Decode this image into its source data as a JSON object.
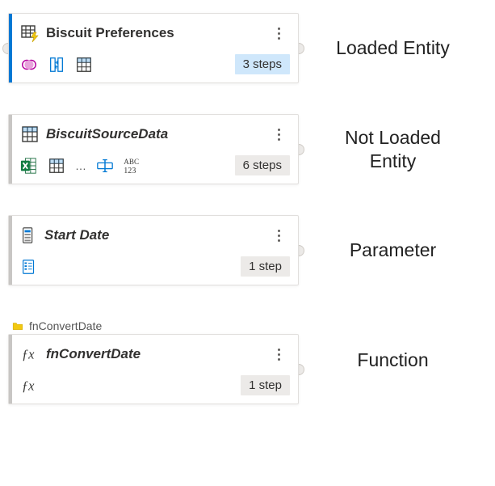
{
  "labels": {
    "loaded_entity": "Loaded Entity",
    "not_loaded_entity": "Not Loaded\nEntity",
    "parameter": "Parameter",
    "function": "Function"
  },
  "nodes": {
    "loaded": {
      "title": "Biscuit Preferences",
      "steps": "3 steps",
      "icons": [
        "table-lightning-icon",
        "venn-icon",
        "split-column-icon",
        "grid-icon"
      ]
    },
    "not_loaded": {
      "title": "BiscuitSourceData",
      "steps": "6 steps",
      "icons": [
        "grid-icon",
        "excel-icon",
        "grid-icon",
        "rename-icon",
        "abc123-icon"
      ],
      "ellipsis": "…"
    },
    "parameter": {
      "title": "Start Date",
      "steps": "1 step",
      "icons": [
        "parameter-icon",
        "list-icon"
      ]
    },
    "function": {
      "group_label": "fnConvertDate",
      "title": "fnConvertDate",
      "steps": "1 step",
      "icons": [
        "fx-icon",
        "fx-icon"
      ]
    }
  }
}
